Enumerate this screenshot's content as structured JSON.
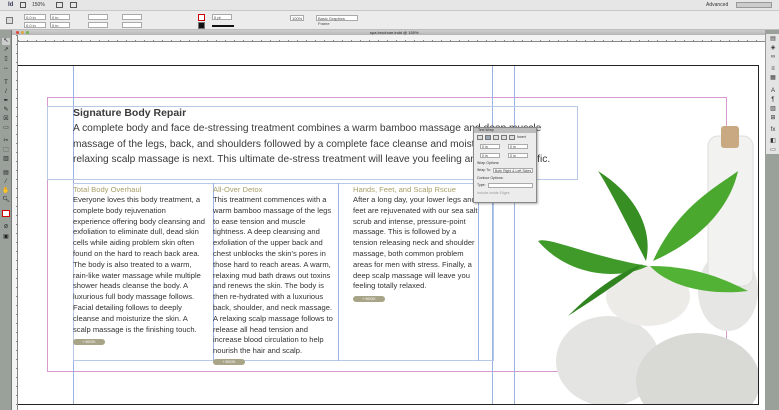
{
  "app_bar": {
    "zoom": "150%",
    "workspace": "Advanced"
  },
  "control_panel": {
    "x": "0.0 in",
    "y": "0.0 in",
    "w": "0 in",
    "h": "0 in",
    "stroke_weight": "0 pt",
    "object_style": "Basic Graphics Frame",
    "percent": "100%"
  },
  "document": {
    "title": "spa brochure.indd @ 150%"
  },
  "text_wrap_panel": {
    "title": "Text Wrap",
    "invert": "Invert",
    "wrap_options": "Wrap Options:",
    "wrap_to": "Wrap To:",
    "wrap_to_value": "Both Right & Left Sides",
    "contour_options": "Contour Options:",
    "type": "Type:",
    "include_inside_edges": "Include Inside Edges",
    "offset_values": [
      "0 in",
      "0 in",
      "0 in",
      "0 in"
    ]
  },
  "content": {
    "heading": "Signature Body Repair",
    "intro": "A complete body and face de-stressing treatment combines a warm bamboo massage and deep muscle massage of the legs, back, and shoulders followed by a complete face cleanse and moisturizing. A relaxing scalp massage is next. This ultimate de-stress treatment will leave you feeling and looking terrific.",
    "columns": [
      {
        "title": "Total Body Overhaul",
        "text": "Everyone loves this body treatment, a complete body rejuvenation experience offering body cleansing and exfoliation to eliminate dull, dead skin cells while aiding problem skin often found on the hard to reach back area. The body is also treated to a warm, rain-like water massage while multiple shower heads cleanse the body. A luxurious full body massage follows. Facial detailing follows to deeply cleanse and moisturize the skin.  A scalp massage is the finishing touch.",
        "button": "+ BOOK"
      },
      {
        "title": "All-Over Detox",
        "text": "This treatment commences with a warm bamboo massage of the legs to ease tension and muscle tightness. A deep cleansing and exfoliation of the upper back and chest unblocks the skin's pores in those hard to reach areas. A warm, relaxing mud bath draws out toxins and renews the skin. The body is then re-hydrated with a luxurious back, shoulder, and neck massage. A relaxing scalp massage follows to release all head tension and increase blood circulation to help nourish the hair and scalp.",
        "button": "+ BOOK"
      },
      {
        "title": "Hands, Feet, and Scalp Rscue",
        "text": "After a long day, your lower legs and feet are rejuvenated with our sea salt scrub and intense, pressure-point massage. This is followed by a tension releasing neck and shoulder massage, both common problem areas for men with stress. Finally, a deep scalp massage will leave you feeling totally relaxed.",
        "button": "+ BOOK"
      }
    ]
  },
  "colors": {
    "accent": "#a9a06a",
    "guide": "#9bb3e0",
    "margin": "#d69ad0",
    "leaf": "#3f9a2a"
  }
}
